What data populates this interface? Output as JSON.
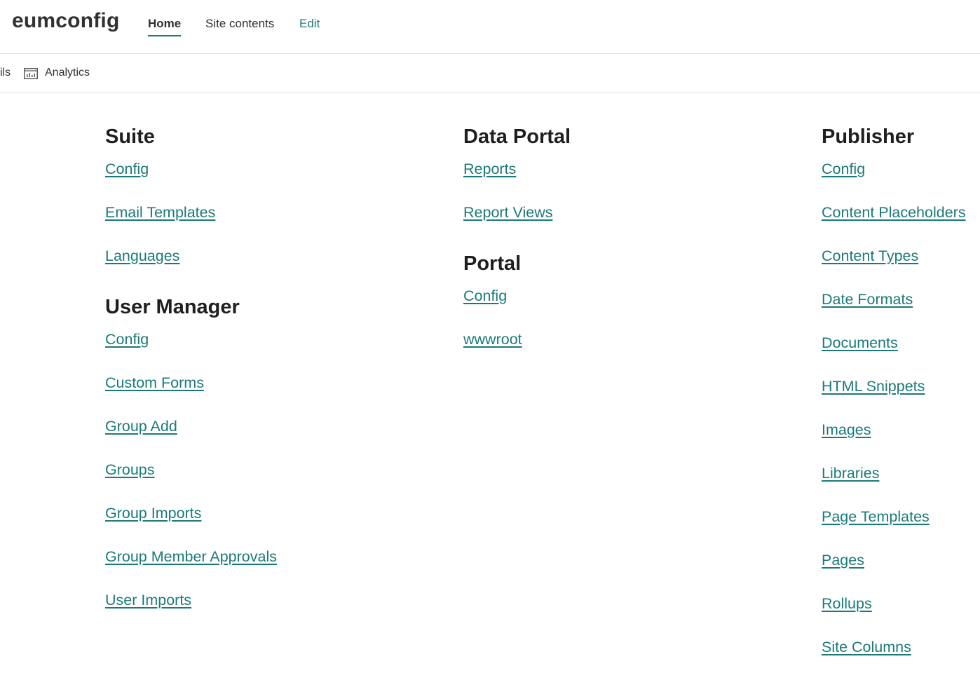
{
  "site": {
    "title": "eumconfig"
  },
  "nav": {
    "home": "Home",
    "site_contents": "Site contents",
    "edit": "Edit"
  },
  "cmdbar": {
    "partial_item": "ils",
    "analytics": "Analytics",
    "analytics_icon": "analytics-icon"
  },
  "colors": {
    "link": "#1b7a78",
    "accent": "#1b7a78",
    "text": "#323130"
  },
  "columns": [
    {
      "sections": [
        {
          "title": "Suite",
          "links": [
            "Config",
            "Email Templates",
            "Languages"
          ]
        },
        {
          "title": "User Manager",
          "links": [
            "Config",
            "Custom Forms",
            "Group Add",
            "Groups",
            "Group Imports",
            "Group Member Approvals",
            "User Imports"
          ]
        }
      ]
    },
    {
      "sections": [
        {
          "title": "Data Portal",
          "links": [
            "Reports",
            "Report Views"
          ]
        },
        {
          "title": "Portal",
          "links": [
            "Config",
            "wwwroot"
          ]
        }
      ]
    },
    {
      "sections": [
        {
          "title": "Publisher",
          "links": [
            "Config",
            "Content Placeholders",
            "Content Types",
            "Date Formats",
            "Documents",
            "HTML Snippets",
            "Images",
            "Libraries",
            "Page Templates",
            "Pages",
            "Rollups",
            "Site Columns"
          ]
        }
      ]
    }
  ]
}
